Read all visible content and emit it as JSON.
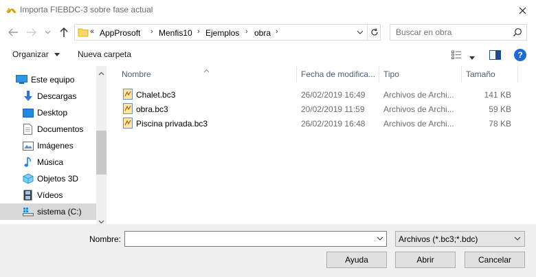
{
  "window": {
    "title": "Importa FIEBDC-3 sobre fase actual"
  },
  "nav": {
    "breadcrumb_prefix": "«",
    "breadcrumb": [
      "AppProsoft",
      "Menfis10",
      "Ejemplos",
      "obra"
    ],
    "search_placeholder": "Buscar en obra"
  },
  "toolbar": {
    "organize_label": "Organizar",
    "new_folder_label": "Nueva carpeta",
    "help_label": "?"
  },
  "sidebar": {
    "items": [
      {
        "label": "Este equipo",
        "icon": "computer-icon"
      },
      {
        "label": "Descargas",
        "icon": "download-icon"
      },
      {
        "label": "Desktop",
        "icon": "desktop-icon"
      },
      {
        "label": "Documentos",
        "icon": "documents-icon"
      },
      {
        "label": "Imágenes",
        "icon": "images-icon"
      },
      {
        "label": "Música",
        "icon": "music-icon"
      },
      {
        "label": "Objetos 3D",
        "icon": "objects3d-icon"
      },
      {
        "label": "Vídeos",
        "icon": "videos-icon"
      },
      {
        "label": "sistema (C:)",
        "icon": "drive-icon",
        "selected": true
      }
    ]
  },
  "columns": {
    "name": "Nombre",
    "date": "Fecha de modifica...",
    "type": "Tipo",
    "size": "Tamaño"
  },
  "files": [
    {
      "name": "Chalet.bc3",
      "date": "26/02/2019 16:49",
      "type": "Archivos de Archi...",
      "size": "141 KB"
    },
    {
      "name": "obra.bc3",
      "date": "20/02/2019 11:59",
      "type": "Archivos de Archi...",
      "size": "59 KB"
    },
    {
      "name": "Piscina privada.bc3",
      "date": "26/02/2019 16:48",
      "type": "Archivos de Archi...",
      "size": "78 KB"
    }
  ],
  "bottom": {
    "filename_label": "Nombre:",
    "filename_value": "",
    "filetype_value": "Archivos (*.bc3;*.bdc)",
    "help_button": "Ayuda",
    "open_button": "Abrir",
    "cancel_button": "Cancelar"
  },
  "colors": {
    "accent": "#0078d7",
    "folder": "#ffd662",
    "header_text": "#4c607a",
    "selection": "#d9d9d9"
  }
}
